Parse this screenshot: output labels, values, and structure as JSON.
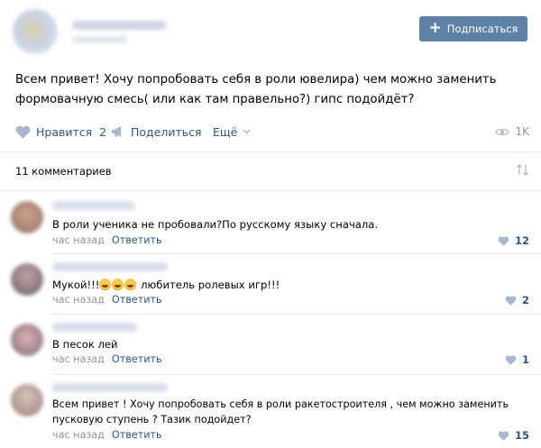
{
  "header": {
    "subscribe_label": "Подписаться"
  },
  "post": {
    "text": "Всем привет! Хочу попробовать себя в роли ювелира) чем можно заменить формовачную смесь( или как там правельно?) гипс подойдёт?"
  },
  "actions": {
    "like_label": "Нравится",
    "like_count": "2",
    "share_label": "Поделиться",
    "more_label": "Ещё",
    "views": "1K"
  },
  "comments_header": {
    "title": "11 комментариев"
  },
  "comments": [
    {
      "text": "В роли ученика не пробовали?По русскому языку сначала.",
      "time": "час назад",
      "reply": "Ответить",
      "likes": "12"
    },
    {
      "text_before": "Мукой!!!",
      "emoji_icon": "rofl-emoji",
      "text_after": " любитель ролевых игр!!!",
      "time": "час назад",
      "reply": "Ответить",
      "likes": "2"
    },
    {
      "text": "В песок лей",
      "time": "час назад",
      "reply": "Ответить",
      "likes": "1"
    },
    {
      "text": "Всем привет ! Хочу попробовать себя в роли ракетостроителя , чем можно заменить пусковую ступень ? Тазик подойдет?",
      "time": "час назад",
      "reply": "Ответить",
      "likes": "15"
    }
  ],
  "colors": {
    "accent": "#5e81a8",
    "link": "#2a5885",
    "muted": "#939393"
  }
}
